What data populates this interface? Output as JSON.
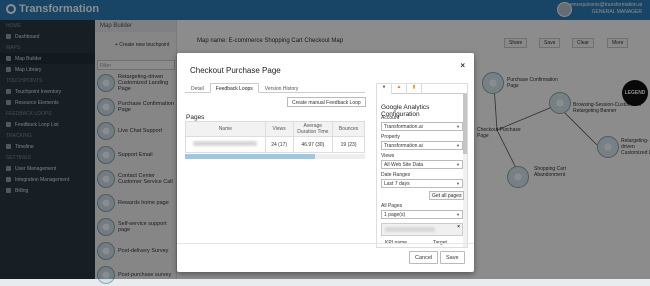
{
  "topbar": {
    "logo_text": "Transformation",
    "user_name": "emrequinonis@transformation.ai",
    "user_role": "GENERAL MANAGER"
  },
  "sidebar": {
    "sections": [
      {
        "label": "HOME",
        "items": [
          "Dashboard"
        ]
      },
      {
        "label": "MAPS",
        "items": [
          "Map Builder",
          "Map Library"
        ]
      },
      {
        "label": "TOUCHPOINTS",
        "items": [
          "Touchpoint Inventory",
          "Resource Elements"
        ]
      },
      {
        "label": "FEEDBACK LOOPS",
        "items": [
          "Feedback Loop List"
        ]
      },
      {
        "label": "TRACKING",
        "items": [
          "Timeline"
        ]
      },
      {
        "label": "SETTINGS",
        "items": [
          "User Management",
          "Integration Management",
          "Billing"
        ]
      }
    ]
  },
  "palette": {
    "header": "Map Builder",
    "new_button": "+ Create new touchpoint",
    "search_placeholder": "Filter",
    "items": [
      "Retargeting-driven Customized Landing Page",
      "Purchase Confirmation Page",
      "Live Chat Support",
      "Support Email",
      "Contact Center Customer Service Call",
      "Rewards home page",
      "Self-service support page",
      "Post-delivery Survey",
      "Post-purchase survey"
    ]
  },
  "canvas": {
    "title": "Map name: E-commerce Shopping Cart Checkout Map",
    "buttons": [
      "Share",
      "Save",
      "Clear",
      "More"
    ],
    "nodes": [
      "Purchase Confirmation Page",
      "Browsing-Session-Customized Retargeting Banner",
      "Checkout Purchase Page",
      "Retargeting-driven Customized L...",
      "Shopping Cart Abandonment"
    ],
    "legend": "LEGEND"
  },
  "modal": {
    "title": "Checkout Purchase Page",
    "close": "×",
    "tabs": [
      "Detail",
      "Feedback Loops",
      "Version History"
    ],
    "active_tab": "Feedback Loops",
    "create_button": "Create manual Feedback Loop",
    "pages_label": "Pages",
    "table": {
      "headers": [
        "Name",
        "Views",
        "Average Duration Time",
        "Bounces"
      ],
      "rows": [
        {
          "views": "24 (17)",
          "avg": "46.97 (30)",
          "bounces": "19 (23)"
        }
      ]
    },
    "right_panel": {
      "tab_icons": [
        "chat-icon",
        "flame-icon",
        "analytics-icon"
      ],
      "heading": "Google Analytics Configuration",
      "account_label": "Account",
      "account_value": "Transformation.ai",
      "property_label": "Property",
      "property_value": "Transformation.ai",
      "views_label": "Views",
      "views_value": "All Web Site Data",
      "date_label": "Date Ranges",
      "date_value": "Last 7 days",
      "get_all_button": "Get all pages",
      "all_pages_label": "All Pages",
      "all_pages_value": "1 page(s)",
      "kpi_col1": "KPI name",
      "kpi_col2": "Target"
    },
    "cancel": "Cancel",
    "save": "Save"
  }
}
